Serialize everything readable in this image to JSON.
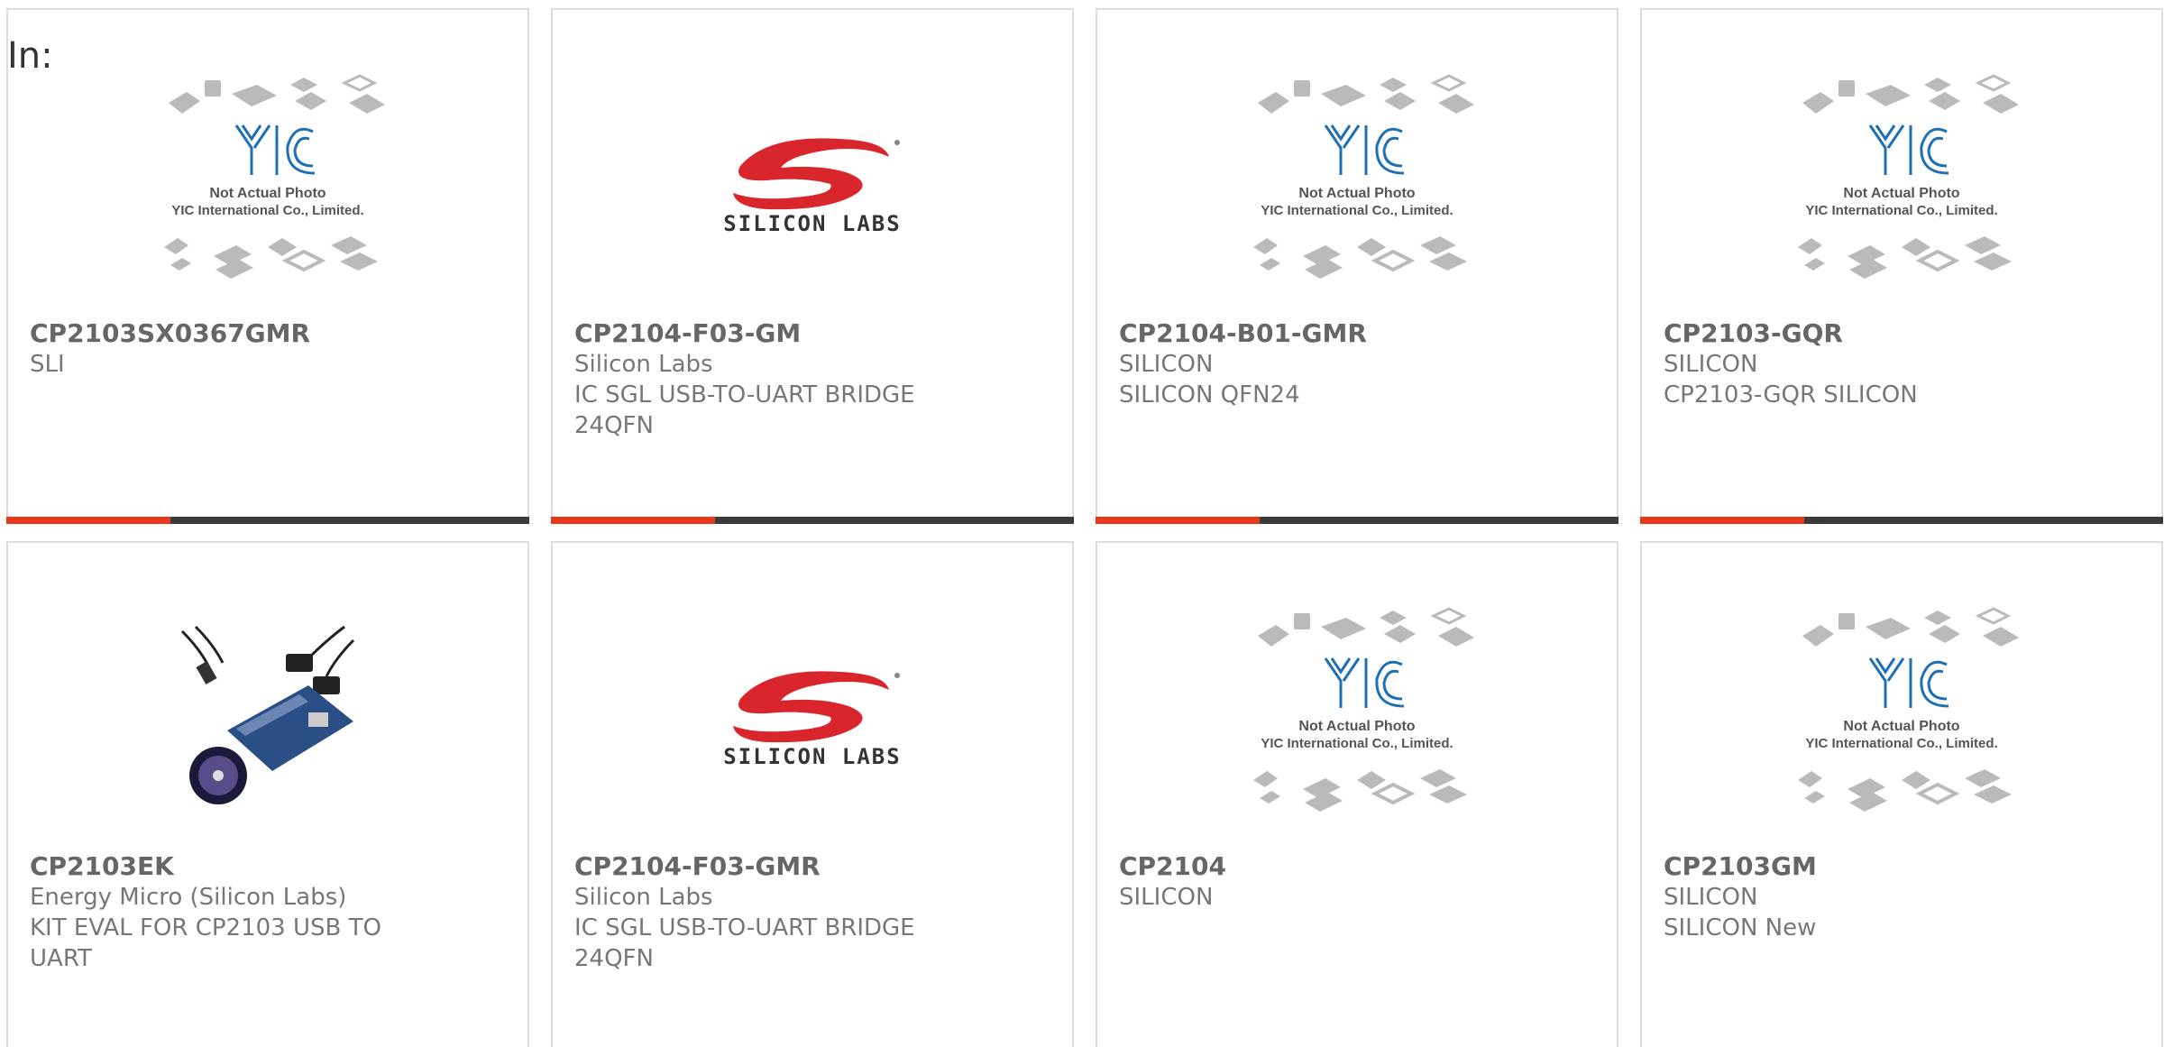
{
  "header": {
    "label": "In:"
  },
  "colors": {
    "accent": "#e8381a",
    "bar": "#3a3a3a",
    "border": "#dddddd",
    "text": "#777777",
    "title": "#666666"
  },
  "products": [
    {
      "part": "CP2103SX0367GMR",
      "maker": "SLI",
      "desc": "",
      "image": "placeholder",
      "placeholder": {
        "line1": "Not Actual Photo",
        "line2": "YIC International Co., Limited."
      }
    },
    {
      "part": "CP2104-F03-GM",
      "maker": "Silicon Labs",
      "desc": "IC SGL USB-TO-UART BRIDGE 24QFN",
      "image": "silicon-labs-logo",
      "logo_text": "SILICON LABS"
    },
    {
      "part": "CP2104-B01-GMR",
      "maker": "SILICON",
      "desc": "SILICON QFN24",
      "image": "placeholder",
      "placeholder": {
        "line1": "Not Actual Photo",
        "line2": "YIC International Co., Limited."
      }
    },
    {
      "part": "CP2103-GQR",
      "maker": "SILICON",
      "desc": "CP2103-GQR SILICON",
      "image": "placeholder",
      "placeholder": {
        "line1": "Not Actual Photo",
        "line2": "YIC International Co., Limited."
      }
    },
    {
      "part": "CP2103EK",
      "maker": "Energy Micro (Silicon Labs)",
      "desc": "KIT EVAL FOR CP2103 USB TO UART",
      "image": "eval-kit-photo"
    },
    {
      "part": "CP2104-F03-GMR",
      "maker": "Silicon Labs",
      "desc": "IC SGL USB-TO-UART BRIDGE 24QFN",
      "image": "silicon-labs-logo",
      "logo_text": "SILICON LABS"
    },
    {
      "part": "CP2104",
      "maker": "SILICON",
      "desc": "",
      "image": "placeholder",
      "placeholder": {
        "line1": "Not Actual Photo",
        "line2": "YIC International Co., Limited."
      }
    },
    {
      "part": "CP2103GM",
      "maker": "SILICON",
      "desc": "SILICON New",
      "image": "placeholder",
      "placeholder": {
        "line1": "Not Actual Photo",
        "line2": "YIC International Co., Limited."
      }
    }
  ]
}
